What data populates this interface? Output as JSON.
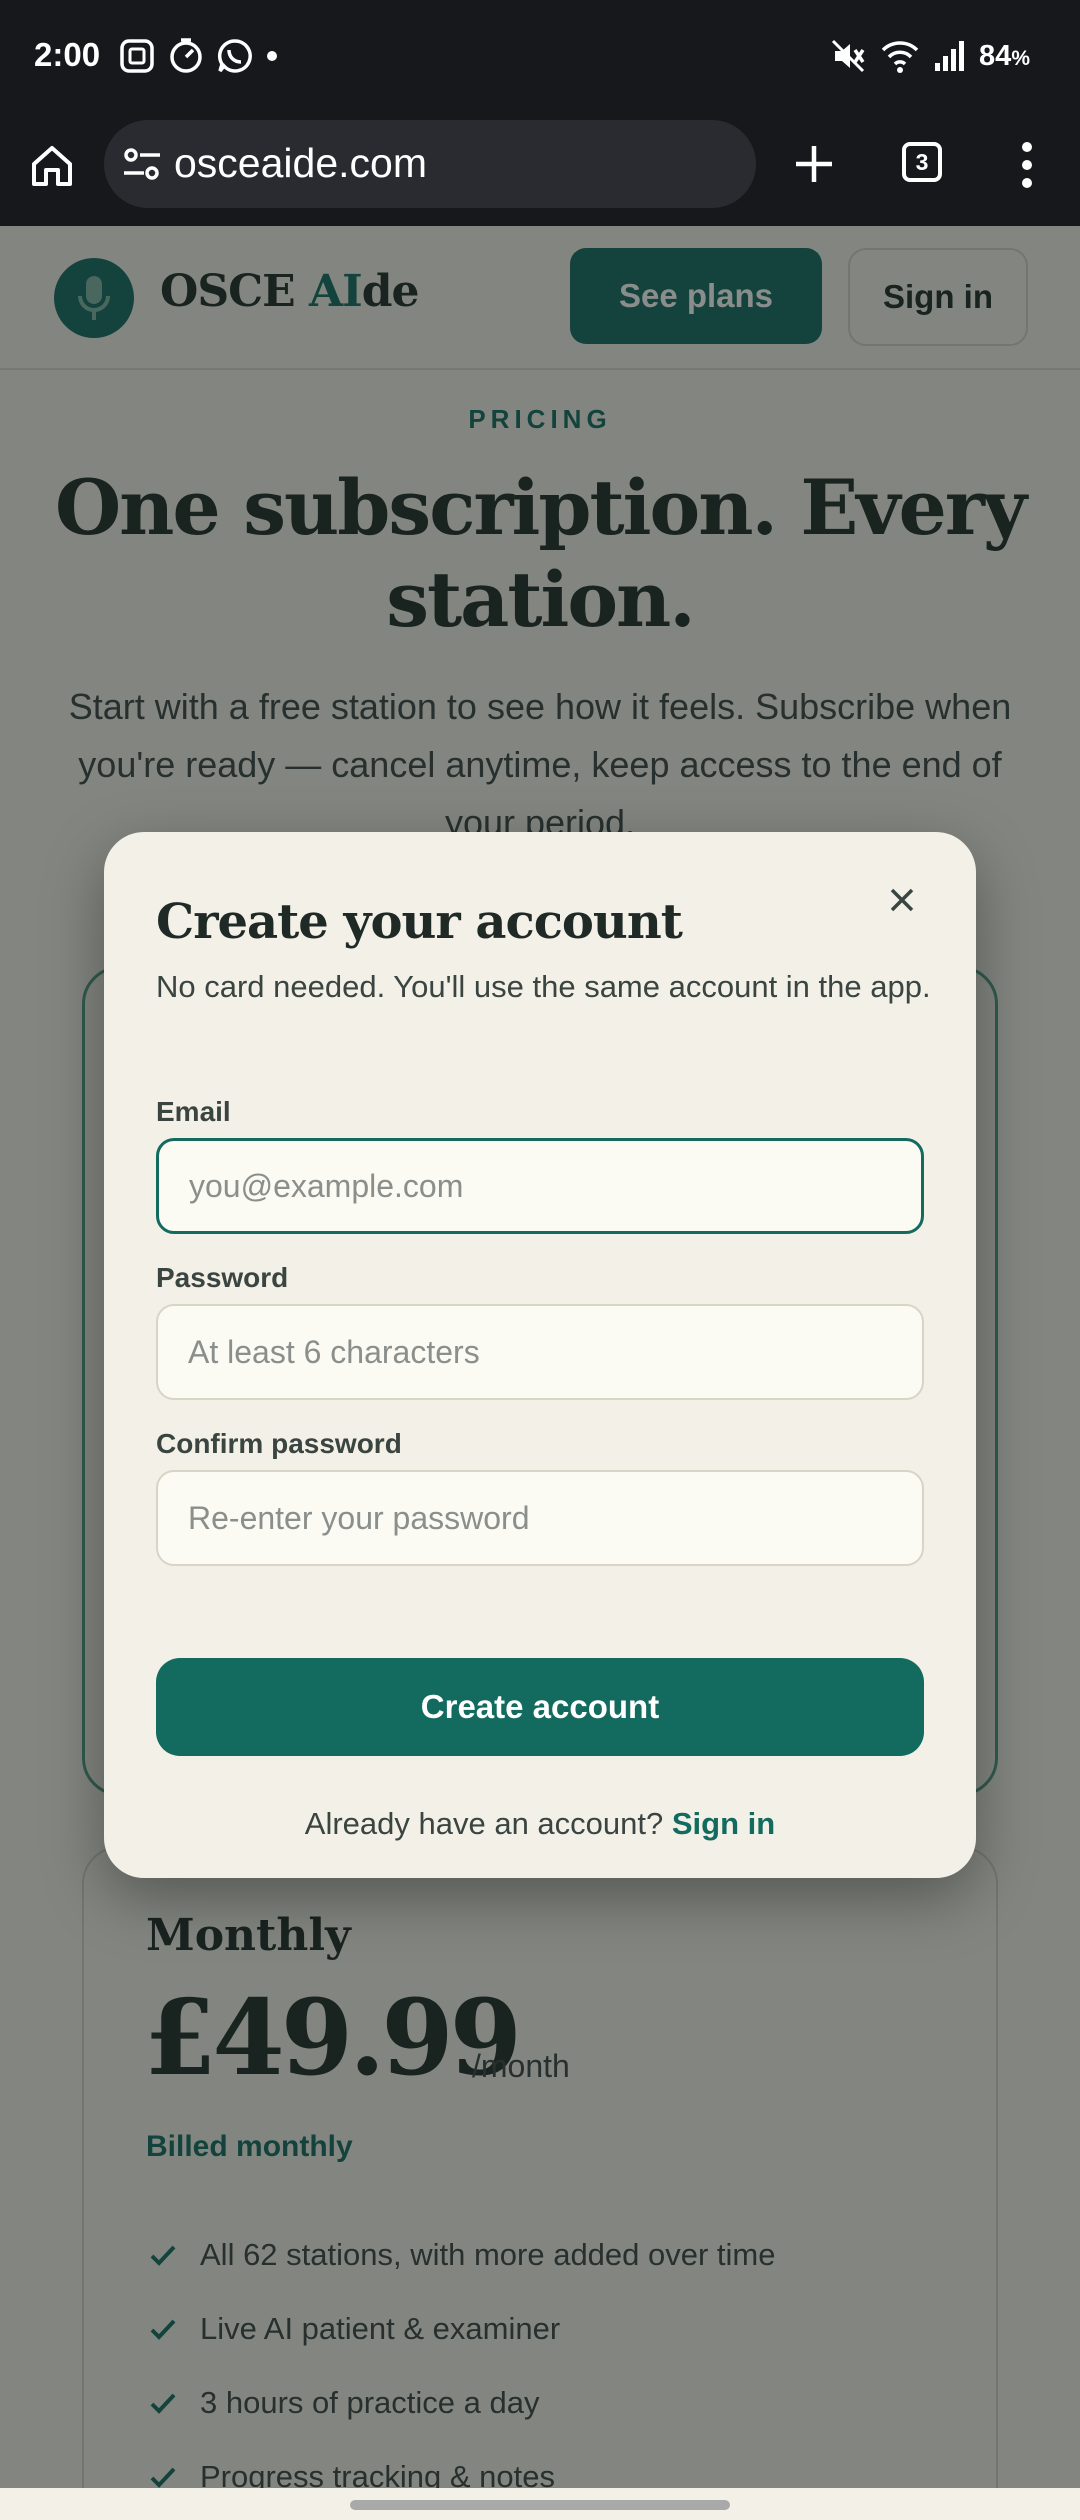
{
  "status_bar": {
    "time": "2:00",
    "battery": "84",
    "battery_unit": "%"
  },
  "browser": {
    "url": "osceaide.com",
    "tab_count": "3"
  },
  "site": {
    "logo_text_plain": "OSCE ",
    "logo_text_accent": "AI",
    "logo_text_tail": "de",
    "see_plans_label": "See plans",
    "sign_in_label": "Sign in",
    "accent_color": "#136b5f"
  },
  "hero": {
    "eyebrow": "PRICING",
    "title": "One subscription. Every station.",
    "subtitle": "Start with a free station to see how it feels. Subscribe when you're ready — cancel anytime, keep access to the end of your period."
  },
  "monthly_plan": {
    "name": "Monthly",
    "price": "£49.99",
    "period": "/month",
    "billed": "Billed monthly",
    "features": [
      "All 62 stations, with more added over time",
      "Live AI patient & examiner",
      "3 hours of practice a day",
      "Progress tracking & notes"
    ]
  },
  "modal": {
    "title": "Create your account",
    "subtitle": "No card needed. You'll use the same account in the app.",
    "email_label": "Email",
    "email_placeholder": "you@example.com",
    "password_label": "Password",
    "password_placeholder": "At least 6 characters",
    "confirm_label": "Confirm password",
    "confirm_placeholder": "Re-enter your password",
    "submit_label": "Create account",
    "have_account_text": "Already have an account? ",
    "sign_in_link": "Sign in"
  }
}
